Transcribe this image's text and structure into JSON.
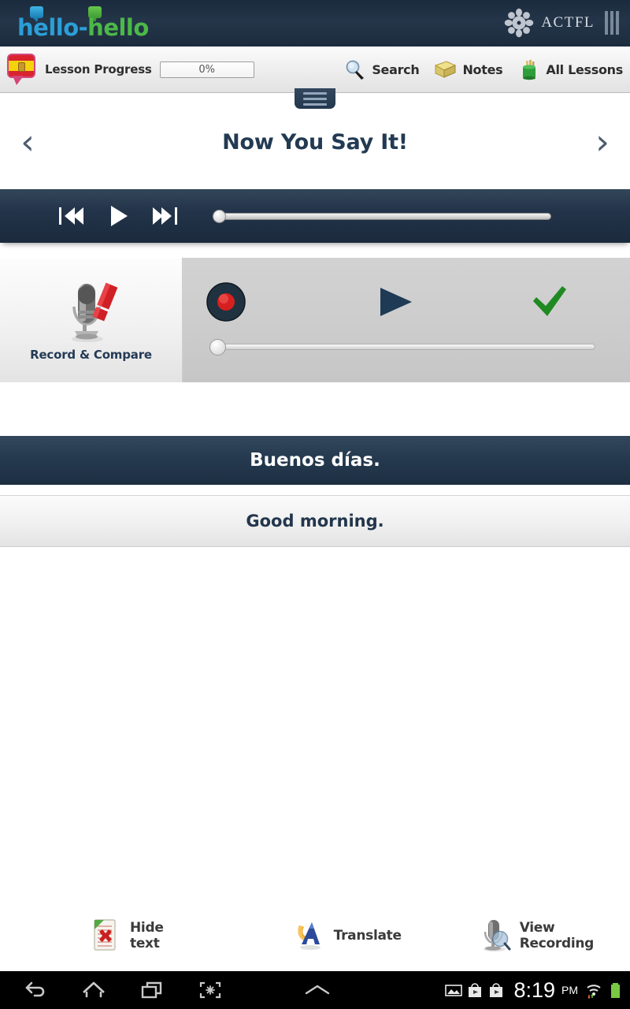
{
  "brand": {
    "logo_text_part1": "hello",
    "logo_dash": "-",
    "logo_text_part2": "hello",
    "partner_label": "ACTFL",
    "colors": {
      "blue": "#2a9fd8",
      "green": "#4cb848",
      "header_dark": "#243549"
    }
  },
  "toolbar": {
    "flag_icon": "spain-flag-pin-icon",
    "progress_label": "Lesson Progress",
    "progress_value": "0%",
    "actions": [
      {
        "icon": "search-icon",
        "label": "Search"
      },
      {
        "icon": "notes-icon",
        "label": "Notes"
      },
      {
        "icon": "all-lessons-icon",
        "label": "All Lessons"
      }
    ]
  },
  "menu_handle": {
    "icon": "hamburger-handle-icon"
  },
  "title_row": {
    "prev_icon": "chevron-left-icon",
    "prev_glyph": "‹",
    "title": "Now You Say It!",
    "next_icon": "chevron-right-icon",
    "next_glyph": "›"
  },
  "player": {
    "prev_track_icon": "skip-previous-icon",
    "play_icon": "play-icon",
    "next_track_icon": "skip-next-icon",
    "progress_percent": 0
  },
  "record_compare": {
    "panel_label": "Record & Compare",
    "mic_icon": "microphone-pencil-icon",
    "record_icon": "record-button-icon",
    "play_icon": "play-triangle-icon",
    "accept_icon": "green-check-icon",
    "slider_percent": 0
  },
  "phrase": {
    "target_language_text": "Buenos días.",
    "native_language_text": "Good morning."
  },
  "bottom_actions": [
    {
      "icon": "hide-text-icon",
      "label": "Hide text"
    },
    {
      "icon": "translate-icon",
      "label": "Translate"
    },
    {
      "icon": "view-recording-icon",
      "label": "View Recording"
    }
  ],
  "system_bar": {
    "back_icon": "back-icon",
    "home_icon": "home-icon",
    "recents_icon": "recent-apps-icon",
    "screenshot_icon": "screenshot-icon",
    "collapse_icon": "collapse-icon",
    "status_icons": [
      "image-icon",
      "app-download-icon",
      "app-download-icon"
    ],
    "clock": "8:19",
    "ampm": "PM",
    "wifi_icon": "wifi-icon",
    "battery_icon": "battery-icon"
  }
}
